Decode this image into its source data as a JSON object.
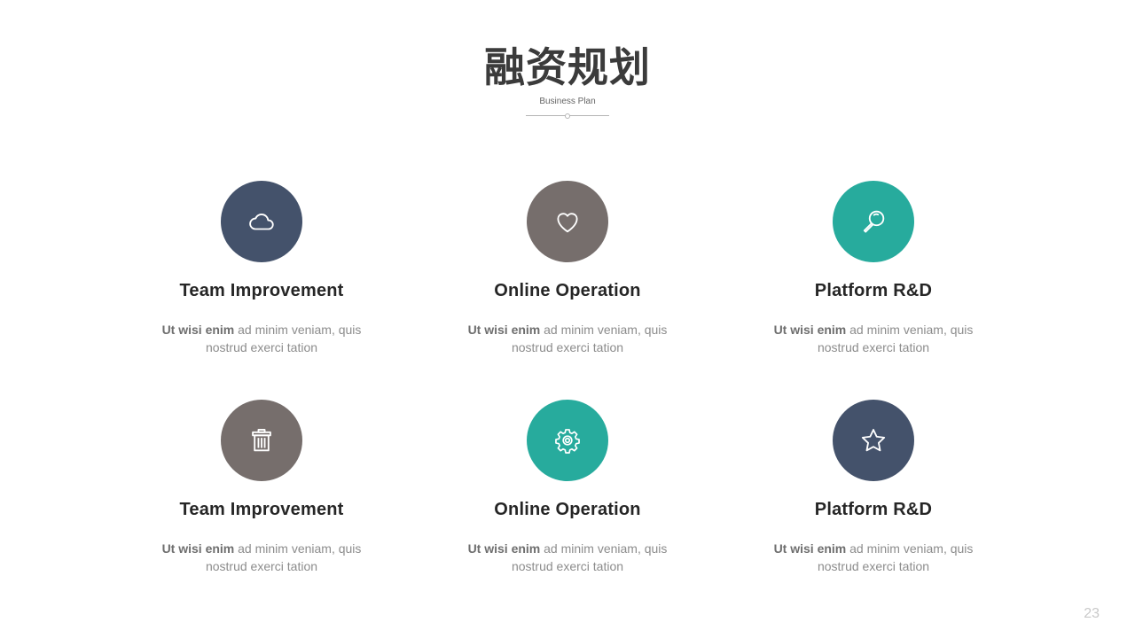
{
  "header": {
    "title": "融资规划",
    "subtitle": "Business Plan"
  },
  "colors": {
    "slate": "#44526b",
    "taupe": "#766e6c",
    "teal": "#27ab9d"
  },
  "cards": [
    {
      "icon": "cloud-icon",
      "color": "#44526b",
      "title": "Team Improvement",
      "desc_lead": "Ut wisi enim",
      "desc_rest": " ad minim veniam, quis nostrud exerci tation"
    },
    {
      "icon": "heart-icon",
      "color": "#766e6c",
      "title": "Online Operation",
      "desc_lead": "Ut wisi enim",
      "desc_rest": " ad minim veniam, quis nostrud exerci tation"
    },
    {
      "icon": "magnifier-icon",
      "color": "#27ab9d",
      "title": "Platform R&D",
      "desc_lead": "Ut wisi enim",
      "desc_rest": " ad minim veniam, quis nostrud exerci tation"
    },
    {
      "icon": "trash-icon",
      "color": "#766e6c",
      "title": "Team Improvement",
      "desc_lead": "Ut wisi enim",
      "desc_rest": " ad minim veniam, quis nostrud exerci tation"
    },
    {
      "icon": "gear-icon",
      "color": "#27ab9d",
      "title": "Online Operation",
      "desc_lead": "Ut wisi enim",
      "desc_rest": " ad minim veniam, quis nostrud exerci tation"
    },
    {
      "icon": "star-icon",
      "color": "#44526b",
      "title": "Platform R&D",
      "desc_lead": "Ut wisi enim",
      "desc_rest": " ad minim veniam, quis nostrud exerci tation"
    }
  ],
  "page_number": "23"
}
